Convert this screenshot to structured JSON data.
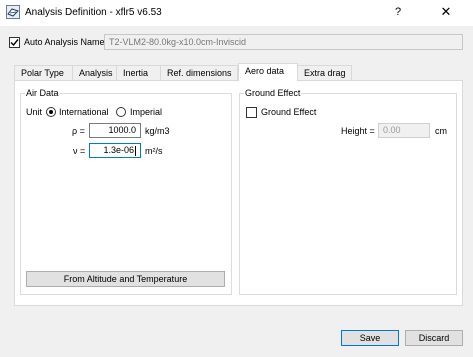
{
  "window": {
    "title": "Analysis Definition - xflr5 v6.53",
    "help_glyph": "?",
    "close_glyph": "✕"
  },
  "auto_analysis": {
    "label": "Auto Analysis Name",
    "checked": true,
    "name_value": "T2-VLM2-80.0kg-x10.0cm-Inviscid"
  },
  "tabs": [
    {
      "label": "Polar Type",
      "active": false
    },
    {
      "label": "Analysis",
      "active": false
    },
    {
      "label": "Inertia",
      "active": false
    },
    {
      "label": "Ref. dimensions",
      "active": false
    },
    {
      "label": "Aero data",
      "active": true
    },
    {
      "label": "Extra drag",
      "active": false
    }
  ],
  "air_data": {
    "title": "Air Data",
    "unit_label": "Unit",
    "units": [
      {
        "label": "International",
        "selected": true
      },
      {
        "label": "Imperial",
        "selected": false
      }
    ],
    "density": {
      "symbol": "ρ =",
      "value": "1000.0",
      "unit": "kg/m3"
    },
    "viscosity": {
      "symbol": "ν =",
      "value": "1.3e-06",
      "unit": "m²/s"
    },
    "altitude_button": "From Altitude and Temperature"
  },
  "ground_effect": {
    "title": "Ground Effect",
    "checkbox_label": "Ground Effect",
    "checked": false,
    "height_label": "Height =",
    "height_value": "0.00",
    "height_unit": "cm"
  },
  "footer": {
    "save_label": "Save",
    "discard_label": "Discard"
  }
}
